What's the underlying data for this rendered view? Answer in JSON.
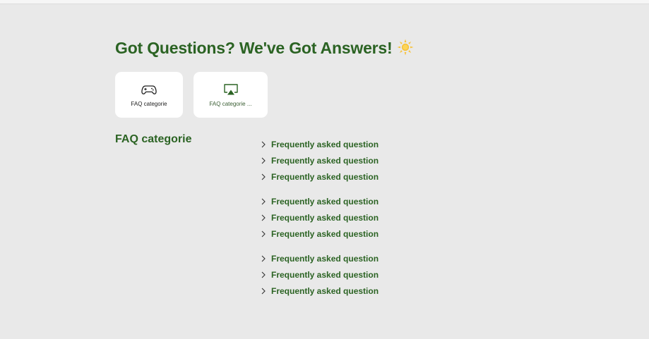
{
  "colors": {
    "background": "#e9e9e9",
    "primary_green": "#2b6323",
    "card_background": "#ffffff",
    "sun": "#f7c23b"
  },
  "header": {
    "title": "Got Questions? We've Got Answers!",
    "title_icon": "sun-emoji"
  },
  "categories": [
    {
      "label": "FAQ categorie",
      "icon": "gamepad-icon"
    },
    {
      "label": "FAQ categorie ...",
      "icon": "airplay-icon"
    }
  ],
  "section": {
    "title": "FAQ categorie"
  },
  "faq_groups": [
    {
      "items": [
        "Frequently asked question",
        "Frequently asked question",
        "Frequently asked question"
      ]
    },
    {
      "items": [
        "Frequently asked question",
        "Frequently asked question",
        "Frequently asked question"
      ]
    },
    {
      "items": [
        "Frequently asked question",
        "Frequently asked question",
        "Frequently asked question"
      ]
    }
  ]
}
